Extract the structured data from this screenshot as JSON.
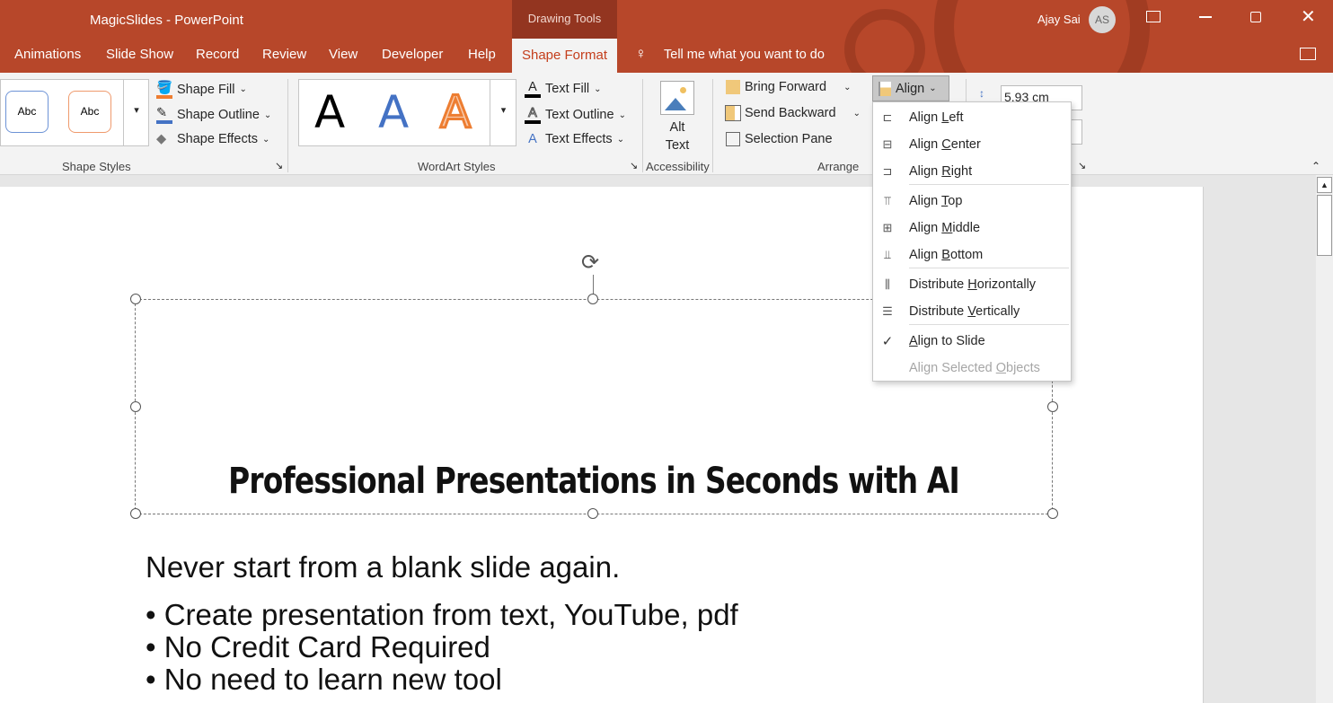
{
  "window": {
    "app_title": "MagicSlides  -  PowerPoint",
    "context_tab_group": "Drawing Tools",
    "user_name": "Ajay Sai",
    "user_initials": "AS"
  },
  "tabs": [
    "Animations",
    "Slide Show",
    "Record",
    "Review",
    "View",
    "Developer",
    "Help",
    "Shape Format"
  ],
  "active_tab": "Shape Format",
  "tell_me": "Tell me what you want to do",
  "ribbon": {
    "shape_styles": {
      "label": "Shape Styles",
      "thumb1": "Abc",
      "thumb2": "Abc",
      "fill": "Shape Fill",
      "outline": "Shape Outline",
      "effects": "Shape Effects"
    },
    "wordart": {
      "label": "WordArt Styles",
      "glyph": "A",
      "text_fill": "Text Fill",
      "text_outline": "Text Outline",
      "text_effects": "Text Effects"
    },
    "accessibility": {
      "label": "Accessibility",
      "alt_text_1": "Alt",
      "alt_text_2": "Text"
    },
    "arrange": {
      "label": "Arrange",
      "bring_forward": "Bring Forward",
      "send_backward": "Send Backward",
      "selection_pane": "Selection Pane",
      "align": "Align"
    },
    "size": {
      "height": "5.93 cm"
    }
  },
  "align_menu": [
    {
      "pre": "Align ",
      "key": "L",
      "post": "eft",
      "icon": "align-left"
    },
    {
      "pre": "Align ",
      "key": "C",
      "post": "enter",
      "icon": "align-center"
    },
    {
      "pre": "Align ",
      "key": "R",
      "post": "ight",
      "icon": "align-right"
    },
    {
      "pre": "Align ",
      "key": "T",
      "post": "op",
      "icon": "align-top"
    },
    {
      "pre": "Align ",
      "key": "M",
      "post": "iddle",
      "icon": "align-middle"
    },
    {
      "pre": "Align ",
      "key": "B",
      "post": "ottom",
      "icon": "align-bottom"
    },
    {
      "pre": "Distribute ",
      "key": "H",
      "post": "orizontally",
      "icon": "distribute-horizontal"
    },
    {
      "pre": "Distribute ",
      "key": "V",
      "post": "ertically",
      "icon": "distribute-vertical"
    },
    {
      "pre": "",
      "key": "A",
      "post": "lign to Slide",
      "icon": "check",
      "checked": true
    },
    {
      "pre": "Align Selected ",
      "key": "O",
      "post": "bjects",
      "disabled": true
    }
  ],
  "slide": {
    "title": "Professional Presentations in Seconds with AI",
    "subtitle": "Never start from a blank slide again.",
    "bullets": [
      "• Create presentation from text, YouTube, pdf",
      "• No Credit Card Required",
      "• No need to learn new tool"
    ]
  },
  "colors": {
    "brand": "#b7472a",
    "accent_text": "#c43e1c"
  }
}
